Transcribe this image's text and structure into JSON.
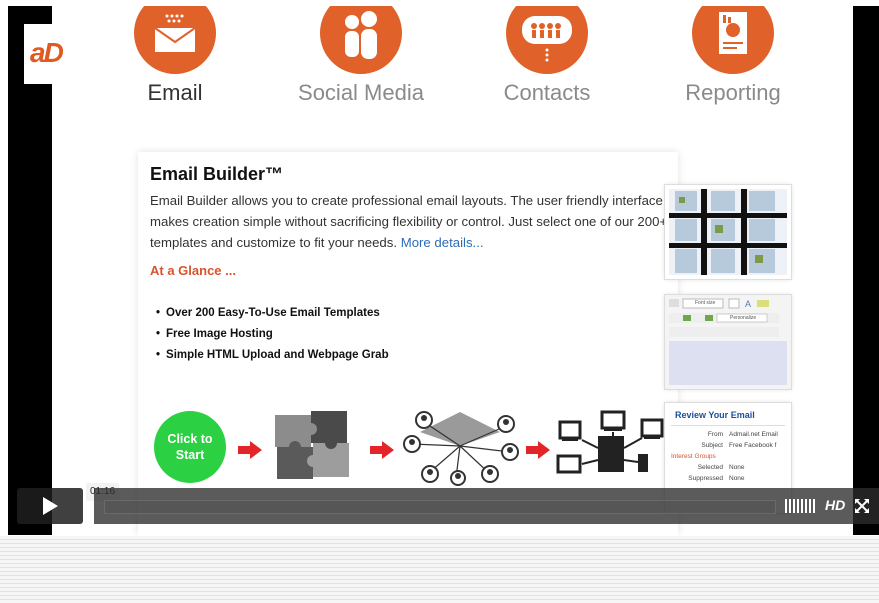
{
  "logo": {
    "text": "aD"
  },
  "nav": [
    {
      "label": "Email",
      "icon": "envelope-icon"
    },
    {
      "label": "Social Media",
      "icon": "people-icon"
    },
    {
      "label": "Contacts",
      "icon": "contacts-icon"
    },
    {
      "label": "Reporting",
      "icon": "report-icon"
    }
  ],
  "card": {
    "title": "Email Builder™",
    "description": "Email Builder allows you to create professional email layouts. The user friendly interface makes creation simple without sacrificing flexibility or control. Just select one of our 200+ templates and customize to fit your needs.",
    "more_link": "More details...",
    "glance": "At a Glance ...",
    "features": [
      "Over 200 Easy-To-Use Email Templates",
      "Free Image Hosting",
      "Simple HTML Upload and Webpage Grab"
    ],
    "click_start": "Click to Start"
  },
  "sidebar": {
    "review": {
      "title": "Review Your Email",
      "rows": [
        {
          "label": "From",
          "value": "Admail.net Email"
        },
        {
          "label": "Subject",
          "value": "Free Facebook f"
        }
      ],
      "group_label": "Interest Groups",
      "rows2": [
        {
          "label": "Selected",
          "value": "None"
        },
        {
          "label": "Suppressed",
          "value": "None"
        }
      ]
    },
    "editor": {
      "font_label": "Font size",
      "personalize_label": "Personalize"
    }
  },
  "player": {
    "time": "01:16",
    "progress": 0,
    "hd_label": "HD",
    "accent": "#e0622a",
    "start_green": "#2bd142"
  }
}
